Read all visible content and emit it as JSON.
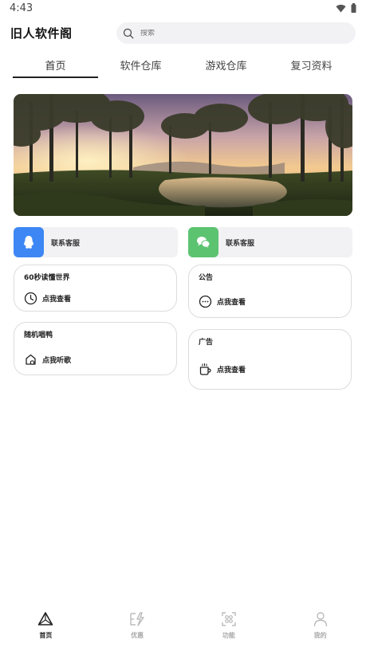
{
  "status_bar": {
    "time": "4:43"
  },
  "header": {
    "app_title": "旧人软件阁",
    "search_placeholder": "搜索"
  },
  "tabs": [
    {
      "label": "首页",
      "active": true
    },
    {
      "label": "软件仓库",
      "active": false
    },
    {
      "label": "游戏仓库",
      "active": false
    },
    {
      "label": "复习资料",
      "active": false
    }
  ],
  "contacts": [
    {
      "label": "联系客服",
      "icon": "qq-icon",
      "color": "#3d87f5"
    },
    {
      "label": "联系客服",
      "icon": "wechat-icon",
      "color": "#5cc371"
    }
  ],
  "cards": {
    "world": {
      "title": "60秒读懂世界",
      "action": "点我查看",
      "icon": "clock-icon"
    },
    "notice": {
      "title": "公告",
      "action": "点我查看",
      "icon": "chat-bubble-icon"
    },
    "music": {
      "title": "随机唱鸭",
      "action": "点我听歌",
      "icon": "music-icon"
    },
    "ad": {
      "title": "广告",
      "action": "点我查看",
      "icon": "coffee-cup-icon"
    }
  },
  "bottom_nav": [
    {
      "label": "首页",
      "icon": "home-triangle-icon",
      "active": true
    },
    {
      "label": "优惠",
      "icon": "lightning-icon",
      "active": false
    },
    {
      "label": "功能",
      "icon": "scan-icon",
      "active": false
    },
    {
      "label": "我的",
      "icon": "user-icon",
      "active": false
    }
  ]
}
